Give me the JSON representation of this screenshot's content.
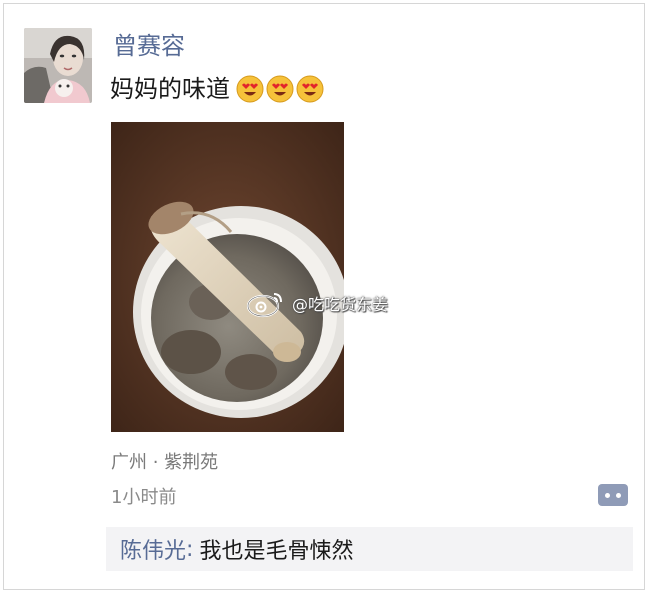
{
  "post": {
    "username": "曾赛容",
    "text": "妈妈的味道",
    "emojis": [
      "heart-eyes-icon",
      "heart-eyes-icon",
      "heart-eyes-icon"
    ],
    "watermark": "@吃吃货东姜",
    "location": "广州 · 紫荆苑",
    "time": "1小时前"
  },
  "comments": [
    {
      "author": "陈伟光",
      "separator": ":",
      "text": "我也是毛骨悚然"
    }
  ],
  "colors": {
    "name_link": "#576b95",
    "comment_bg": "#f3f3f5",
    "action_button": "#8f9bb7"
  }
}
